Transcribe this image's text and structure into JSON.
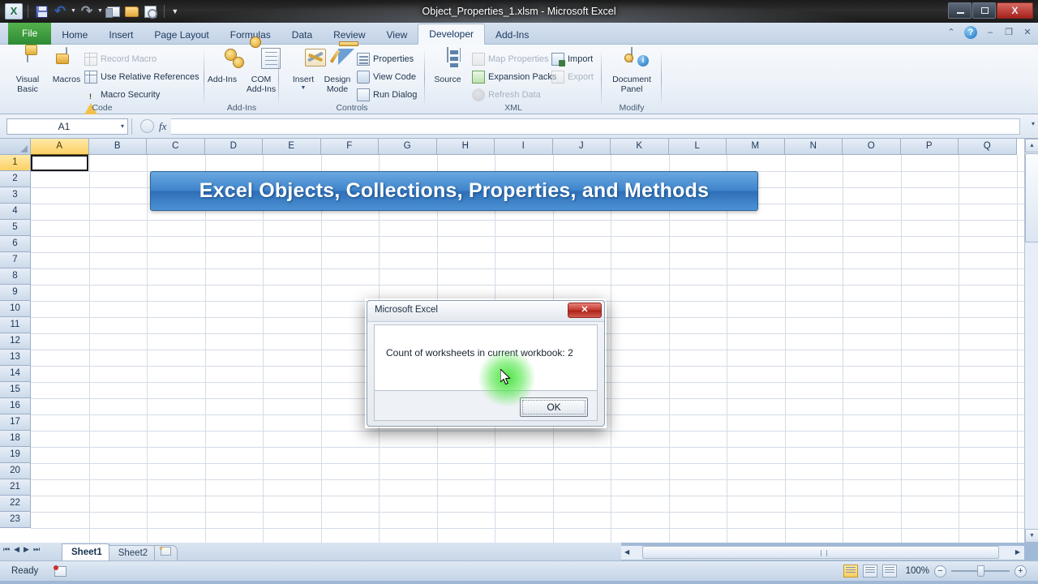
{
  "window": {
    "title": "Object_Properties_1.xlsm  -  Microsoft Excel",
    "minimize_label": "Minimize",
    "maximize_label": "Maximize",
    "close_label": "X"
  },
  "quick_access": {
    "logo": "excel-logo",
    "items": [
      {
        "name": "save-icon",
        "label": "Save"
      },
      {
        "name": "undo-icon",
        "label": "↶"
      },
      {
        "name": "undo-caret",
        "label": "▾"
      },
      {
        "name": "redo-icon",
        "label": "↷"
      },
      {
        "name": "redo-caret",
        "label": "▾"
      },
      {
        "name": "email-icon",
        "label": "E-mail"
      },
      {
        "name": "open-icon",
        "label": "Open"
      },
      {
        "name": "print-preview-icon",
        "label": "Print Preview"
      },
      {
        "name": "customize-qat-caret",
        "label": "▾"
      }
    ]
  },
  "tabs": [
    {
      "label": "File",
      "active": false,
      "is_file": true
    },
    {
      "label": "Home",
      "active": false
    },
    {
      "label": "Insert",
      "active": false
    },
    {
      "label": "Page Layout",
      "active": false
    },
    {
      "label": "Formulas",
      "active": false
    },
    {
      "label": "Data",
      "active": false
    },
    {
      "label": "Review",
      "active": false
    },
    {
      "label": "View",
      "active": false
    },
    {
      "label": "Developer",
      "active": true
    },
    {
      "label": "Add-Ins",
      "active": false
    }
  ],
  "tab_right": {
    "collapse_ribbon": "⌃",
    "help": "?",
    "minimize_doc": "–",
    "restore_doc": "❐",
    "close_doc": "✕"
  },
  "ribbon": {
    "groups": [
      {
        "name": "Code",
        "label": "Code",
        "big_buttons": [
          {
            "label_line1": "Visual",
            "label_line2": "Basic",
            "icon": "visual-basic-icon"
          },
          {
            "label_line1": "Macros",
            "label_line2": "",
            "icon": "macros-icon"
          }
        ],
        "small_buttons": [
          {
            "label": "Record Macro",
            "icon": "record-macro-icon",
            "disabled": true
          },
          {
            "label": "Use Relative References",
            "icon": "relative-references-icon",
            "disabled": false
          },
          {
            "label": "Macro Security",
            "icon": "macro-security-icon",
            "disabled": false
          }
        ]
      },
      {
        "name": "Add-Ins",
        "label": "Add-Ins",
        "big_buttons": [
          {
            "label_line1": "Add-Ins",
            "label_line2": "",
            "icon": "add-ins-icon"
          },
          {
            "label_line1": "COM",
            "label_line2": "Add-Ins",
            "icon": "com-add-ins-icon"
          }
        ],
        "small_buttons": []
      },
      {
        "name": "Controls",
        "label": "Controls",
        "big_buttons": [
          {
            "label_line1": "Insert",
            "label_line2": "",
            "icon": "insert-control-icon",
            "has_caret": true
          },
          {
            "label_line1": "Design",
            "label_line2": "Mode",
            "icon": "design-mode-icon"
          }
        ],
        "small_buttons": [
          {
            "label": "Properties",
            "icon": "properties-icon",
            "disabled": false
          },
          {
            "label": "View Code",
            "icon": "view-code-icon",
            "disabled": false
          },
          {
            "label": "Run Dialog",
            "icon": "run-dialog-icon",
            "disabled": false
          }
        ]
      },
      {
        "name": "XML",
        "label": "XML",
        "big_buttons": [
          {
            "label_line1": "Source",
            "label_line2": "",
            "icon": "xml-source-icon"
          }
        ],
        "small_buttons": [
          {
            "label": "Map Properties",
            "icon": "map-properties-icon",
            "disabled": true
          },
          {
            "label": "Expansion Packs",
            "icon": "expansion-packs-icon",
            "disabled": false
          },
          {
            "label": "Refresh Data",
            "icon": "refresh-data-icon",
            "disabled": true
          },
          {
            "label": "Import",
            "icon": "import-icon",
            "disabled": false
          },
          {
            "label": "Export",
            "icon": "export-icon",
            "disabled": true
          }
        ]
      },
      {
        "name": "Modify",
        "label": "Modify",
        "big_buttons": [
          {
            "label_line1": "Document",
            "label_line2": "Panel",
            "icon": "document-panel-icon"
          }
        ],
        "small_buttons": []
      }
    ]
  },
  "formula_bar": {
    "name_box_value": "A1",
    "name_box_caret": "▾",
    "cancel_icon": "cancel-icon",
    "enter_icon": "enter-icon",
    "fx_label": "fx",
    "formula_value": "",
    "expand_caret": "▾"
  },
  "grid": {
    "columns": [
      "A",
      "B",
      "C",
      "D",
      "E",
      "F",
      "G",
      "H",
      "I",
      "J",
      "K",
      "L",
      "M",
      "N",
      "O",
      "P",
      "Q"
    ],
    "rows": [
      "1",
      "2",
      "3",
      "4",
      "5",
      "6",
      "7",
      "8",
      "9",
      "10",
      "11",
      "12",
      "13",
      "14",
      "15",
      "16",
      "17",
      "18",
      "19",
      "20",
      "21",
      "22",
      "23"
    ],
    "selected_column": "A",
    "selected_row": "1",
    "active_cell": "A1"
  },
  "banner": {
    "text": "Excel Objects, Collections, Properties, and Methods",
    "background_color": "#3f85cc",
    "text_color": "#ffffff"
  },
  "sheet_tabs": {
    "nav_first": "⏮",
    "nav_prev": "◀",
    "nav_next": "▶",
    "nav_last": "⏭",
    "tabs": [
      {
        "label": "Sheet1",
        "active": true
      },
      {
        "label": "Sheet2",
        "active": false
      }
    ],
    "insert_sheet_label": "Insert Worksheet"
  },
  "status_bar": {
    "status": "Ready",
    "macro_record_icon": "record-macro-status-icon",
    "views": [
      {
        "name": "normal-view",
        "active": true
      },
      {
        "name": "page-layout-view",
        "active": false
      },
      {
        "name": "page-break-preview-view",
        "active": false
      }
    ],
    "zoom_level": "100%",
    "zoom_out": "−",
    "zoom_in": "+"
  },
  "dialog": {
    "title": "Microsoft Excel",
    "close_label": "✕",
    "message": "Count of worksheets in current workbook: 2",
    "ok_label": "OK"
  },
  "scrollbars": {
    "v_up": "▲",
    "v_down": "▼",
    "h_left": "◀",
    "h_right": "▶"
  }
}
